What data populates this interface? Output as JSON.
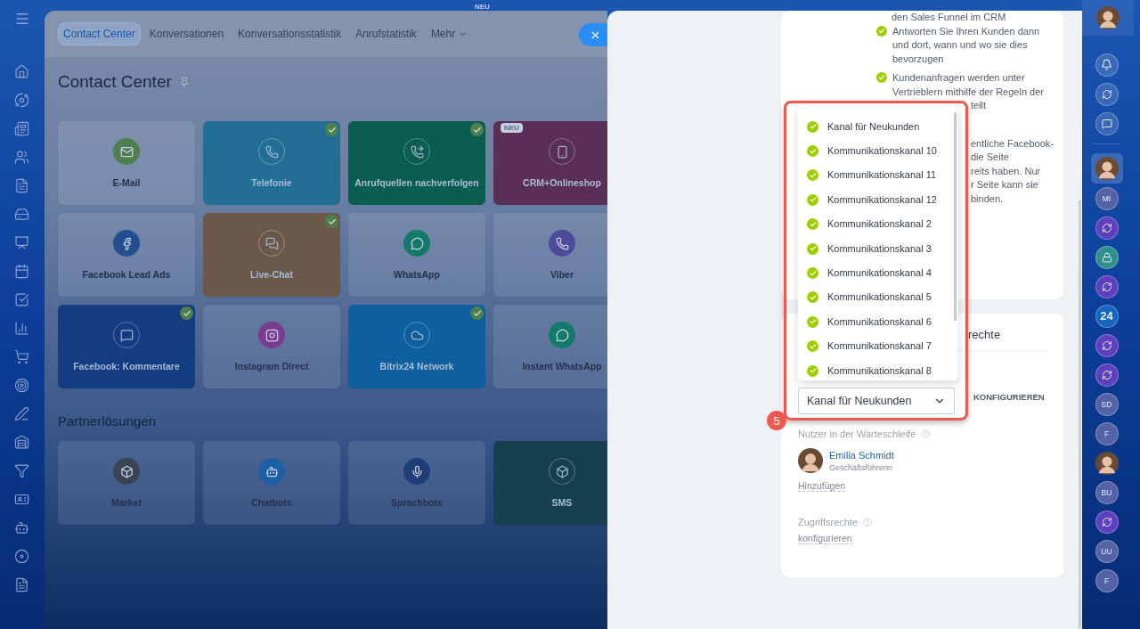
{
  "top_badge": "NEU",
  "tabs": [
    {
      "label": "Contact Center",
      "selected": true,
      "dropdown": false
    },
    {
      "label": "Konversationen",
      "selected": false,
      "dropdown": false
    },
    {
      "label": "Konversationsstatistik",
      "selected": false,
      "dropdown": false
    },
    {
      "label": "Anrufstatistik",
      "selected": false,
      "dropdown": false
    },
    {
      "label": "Mehr",
      "selected": false,
      "dropdown": true
    }
  ],
  "page_title": "Contact Center",
  "tiles": [
    {
      "label": "E-Mail",
      "kind": "plain",
      "color": "#4f7f4e",
      "checked": false
    },
    {
      "label": "Telefonie",
      "kind": "filled",
      "color": "#226e95",
      "checked": true
    },
    {
      "label": "Anrufquellen nachverfolgen",
      "kind": "filled",
      "color": "#0a5e50",
      "checked": true
    },
    {
      "label": "CRM+Onlineshop",
      "kind": "filled",
      "color": "#5a2e55",
      "checked": false,
      "badge": "NEU"
    },
    {
      "label": "Facebook Lead Ads",
      "kind": "plain",
      "color": "#234f90",
      "checked": false
    },
    {
      "label": "Live-Chat",
      "kind": "filled",
      "color": "#6b5848",
      "checked": true
    },
    {
      "label": "WhatsApp",
      "kind": "plain",
      "color": "#137a6a",
      "checked": false
    },
    {
      "label": "Viber",
      "kind": "plain",
      "color": "#4e4c9a",
      "checked": false
    },
    {
      "label": "Facebook: Kommentare",
      "kind": "filled",
      "color": "#143c80",
      "checked": true
    },
    {
      "label": "Instagram Direct",
      "kind": "plain",
      "color": "#7a3d8e",
      "checked": false
    },
    {
      "label": "Bitrix24 Network",
      "kind": "filled",
      "color": "#0d5fa0",
      "checked": true
    },
    {
      "label": "Instant WhatsApp",
      "kind": "plain",
      "color": "#137a6a",
      "checked": false
    }
  ],
  "partner_heading": "Partnerlösungen",
  "partner_tiles": [
    {
      "label": "Market",
      "kind": "plain",
      "color": "#3b4455",
      "checked": false
    },
    {
      "label": "Chatbots",
      "kind": "plain",
      "color": "#1d5fa6",
      "checked": false
    },
    {
      "label": "Sprachbots",
      "kind": "plain",
      "color": "#1f3e7a",
      "checked": false
    },
    {
      "label": "SMS",
      "kind": "filled",
      "color": "#163f50",
      "checked": false
    }
  ],
  "info_card": {
    "intro_tail": "den Sales Funnel im CRM",
    "bullets": [
      {
        "text": "Antworten Sie Ihren Kunden dann und dort, wann und wo sie dies bevorzugen"
      },
      {
        "text": "Kundenanfragen werden unter Vertrieblern mithilfe der Regeln der",
        "covered_tail": "teilt"
      }
    ],
    "covered_lines": [
      "entliche Facebook-",
      "die Seite",
      "reits haben. Nur",
      "r Seite kann sie",
      "binden."
    ]
  },
  "settings_card": {
    "heading_tail": "rechte",
    "queue_select": {
      "value": "Kanal für Neukunden"
    },
    "configure_button": "KONFIGURIEREN",
    "users_label": "Nutzer in der Warteschleife",
    "users": [
      {
        "name": "Emilia Schmidt",
        "role": "Geschäftsführerin"
      }
    ],
    "add_link": "Hinzufügen",
    "access_label": "Zugriffsrechte",
    "access_link": "konfigurieren"
  },
  "dropdown_options": [
    "Kanal für Neukunden",
    "Kommunikationskanal 10",
    "Kommunikationskanal 11",
    "Kommunikationskanal 12",
    "Kommunikationskanal 2",
    "Kommunikationskanal 3",
    "Kommunikationskanal 4",
    "Kommunikationskanal 5",
    "Kommunikationskanal 6",
    "Kommunikationskanal 7",
    "Kommunikationskanal 8"
  ],
  "step_marker": "5",
  "right_sidebar": [
    {
      "kind": "avatar",
      "selected": false
    },
    {
      "kind": "bell",
      "selected": false
    },
    {
      "kind": "swirl-icon",
      "selected": false
    },
    {
      "kind": "chat",
      "selected": false
    },
    {
      "kind": "avatar",
      "selected": true
    },
    {
      "kind": "initials",
      "text": "MI",
      "selected": false
    },
    {
      "kind": "swirl",
      "selected": false
    },
    {
      "kind": "lock",
      "selected": false
    },
    {
      "kind": "swirl",
      "selected": false
    },
    {
      "kind": "brand",
      "text": "24",
      "selected": false
    },
    {
      "kind": "swirl",
      "selected": false
    },
    {
      "kind": "swirl",
      "selected": false
    },
    {
      "kind": "initials",
      "text": "SD",
      "selected": false
    },
    {
      "kind": "initials",
      "text": "F",
      "selected": false
    },
    {
      "kind": "avatar",
      "selected": false
    },
    {
      "kind": "initials",
      "text": "BU",
      "selected": false
    },
    {
      "kind": "swirl",
      "selected": false
    },
    {
      "kind": "initials",
      "text": "UU",
      "selected": false
    },
    {
      "kind": "initials",
      "text": "F",
      "selected": false
    }
  ]
}
